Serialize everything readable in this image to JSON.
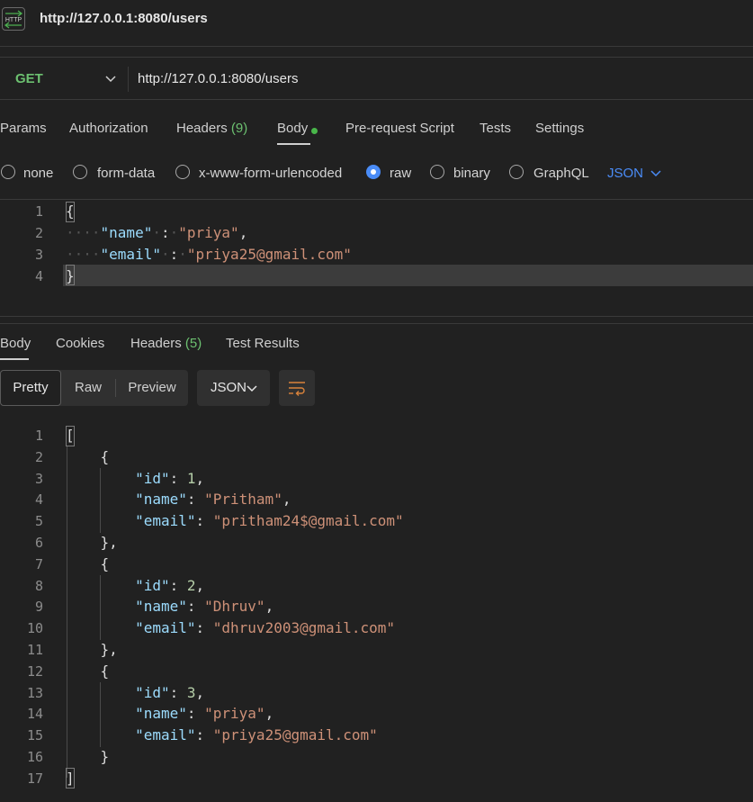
{
  "title_bar": {
    "icon": "http-icon",
    "icon_text": "HTTP",
    "title": "http://127.0.0.1:8080/users"
  },
  "request": {
    "method": "GET",
    "url": "http://127.0.0.1:8080/users",
    "tabs": [
      {
        "label": "Params"
      },
      {
        "label": "Authorization"
      },
      {
        "label": "Headers",
        "count": "(9)"
      },
      {
        "label": "Body",
        "active": true
      },
      {
        "label": "Pre-request Script"
      },
      {
        "label": "Tests"
      },
      {
        "label": "Settings"
      }
    ],
    "body_types": [
      "none",
      "form-data",
      "x-www-form-urlencoded",
      "raw",
      "binary",
      "GraphQL"
    ],
    "selected_body_type": "raw",
    "content_type": "JSON",
    "line_numbers": [
      "1",
      "2",
      "3",
      "4"
    ],
    "body_text": {
      "l1": "{",
      "l2_key": "\"name\"",
      "l2_sep": ":",
      "l2_val": "\"priya\"",
      "l2_end": ",",
      "l3_key": "\"email\"",
      "l3_sep": ":",
      "l3_val": "\"priya25@gmail.com\"",
      "l4": "}"
    }
  },
  "response": {
    "tabs": [
      {
        "label": "Body",
        "active": true
      },
      {
        "label": "Cookies"
      },
      {
        "label": "Headers",
        "count": "(5)"
      },
      {
        "label": "Test Results"
      }
    ],
    "views": [
      "Pretty",
      "Raw",
      "Preview"
    ],
    "active_view": "Pretty",
    "format": "JSON",
    "wrap_icon": "wrap-lines-icon",
    "line_numbers": [
      "1",
      "2",
      "3",
      "4",
      "5",
      "6",
      "7",
      "8",
      "9",
      "10",
      "11",
      "12",
      "13",
      "14",
      "15",
      "16",
      "17"
    ],
    "users": [
      {
        "id": "1",
        "name": "\"Pritham\"",
        "email": "\"pritham24$@gmail.com\""
      },
      {
        "id": "2",
        "name": "\"Dhruv\"",
        "email": "\"dhruv2003@gmail.com\""
      },
      {
        "id": "3",
        "name": "\"priya\"",
        "email": "\"priya25@gmail.com\""
      }
    ],
    "punct": {
      "open_array": "[",
      "close_array": "]",
      "open_obj": "{",
      "close_obj_comma": "},",
      "close_obj": "}",
      "key_id": "\"id\"",
      "key_name": "\"name\"",
      "key_email": "\"email\"",
      "colon": ": ",
      "comma": ","
    }
  },
  "colors": {
    "accent_blue": "#4a8cf7",
    "method_green": "#6cc070",
    "json_key": "#9cdcfe",
    "json_string": "#ce9178",
    "json_number": "#b5cea8"
  }
}
